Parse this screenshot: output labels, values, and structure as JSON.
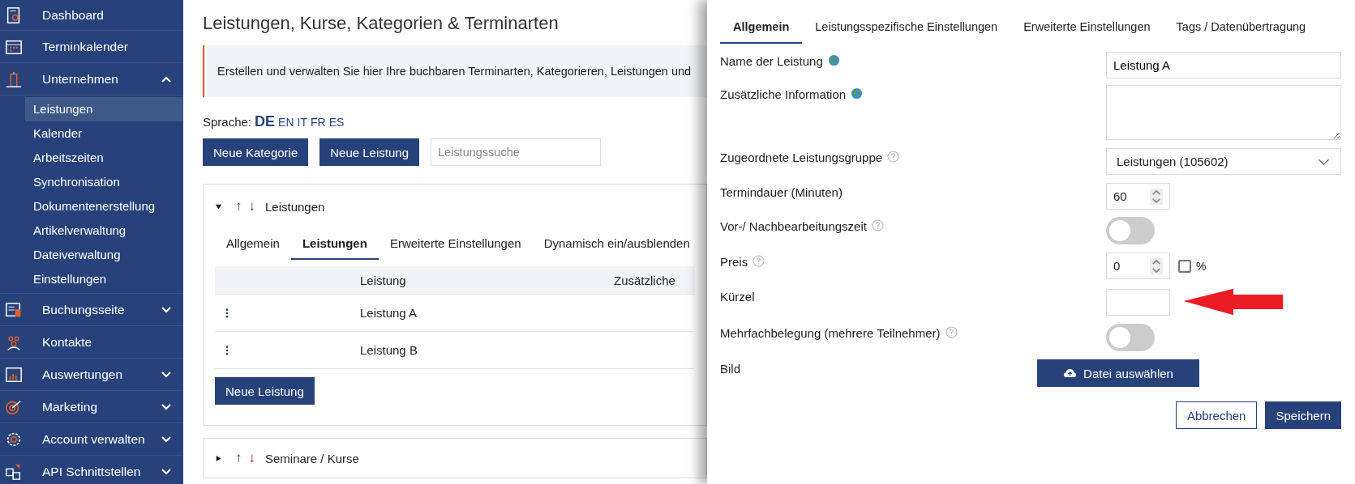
{
  "sidebar": {
    "items": [
      {
        "label": "Dashboard"
      },
      {
        "label": "Terminkalender"
      },
      {
        "label": "Unternehmen",
        "expanded": true,
        "children": [
          {
            "label": "Leistungen",
            "selected": true
          },
          {
            "label": "Kalender",
            "selected": false
          },
          {
            "label": "Arbeitszeiten",
            "selected": false
          },
          {
            "label": "Synchronisation",
            "selected": false
          },
          {
            "label": "Dokumentenerstellung",
            "selected": false
          },
          {
            "label": "Artikelverwaltung",
            "selected": false
          },
          {
            "label": "Dateiverwaltung",
            "selected": false
          },
          {
            "label": "Einstellungen",
            "selected": false
          }
        ]
      },
      {
        "label": "Buchungsseite",
        "expanded": false
      },
      {
        "label": "Kontakte"
      },
      {
        "label": "Auswertungen",
        "expanded": false
      },
      {
        "label": "Marketing",
        "expanded": false
      },
      {
        "label": "Account verwalten",
        "expanded": false
      },
      {
        "label": "API Schnittstellen",
        "expanded": false
      }
    ]
  },
  "main": {
    "title": "Leistungen, Kurse, Kategorien & Terminarten",
    "info": "Erstellen und verwalten Sie hier Ihre buchbaren Terminarten, Kategorieren, Leistungen und",
    "language_label": "Sprache:",
    "languages": [
      {
        "code": "DE",
        "selected": true
      },
      {
        "code": "EN",
        "selected": false
      },
      {
        "code": "IT",
        "selected": false
      },
      {
        "code": "FR",
        "selected": false
      },
      {
        "code": "ES",
        "selected": false
      }
    ],
    "buttons": [
      "Neue Kategorie",
      "Neue Leistung"
    ],
    "search": {
      "placeholder": "Leistungssuche"
    },
    "sections": [
      {
        "title": "Leistungen",
        "up": "↑",
        "down": "↓",
        "expanded": true,
        "tabs": [
          {
            "label": "Allgemein",
            "selected": false
          },
          {
            "label": "Leistungen",
            "selected": true
          },
          {
            "label": "Erweiterte Einstellungen",
            "selected": false
          },
          {
            "label": "Dynamisch ein/ausblenden",
            "selected": false
          }
        ],
        "table": {
          "columns": [
            "Leistung",
            "Zusätzliche"
          ],
          "rows": [
            {
              "cells": [
                "Leistung A"
              ]
            },
            {
              "cells": [
                "Leistung B"
              ]
            }
          ]
        },
        "add_button": "Neue Leistung"
      },
      {
        "title": "Seminare / Kurse",
        "up": "↑",
        "down": "↓",
        "expanded": false
      }
    ]
  },
  "panel": {
    "tabs": [
      {
        "label": "Allgemein",
        "selected": true
      },
      {
        "label": "Leistungsspezifische Einstellungen",
        "selected": false
      },
      {
        "label": "Erweiterte Einstellungen",
        "selected": false
      },
      {
        "label": "Tags / Datenübertragung",
        "selected": false
      }
    ],
    "fields": [
      {
        "label": "Name der Leistung",
        "translatable": true,
        "kind": "text",
        "value": "Leistung A"
      },
      {
        "label": "Zusätzliche Information",
        "translatable": true,
        "kind": "textarea"
      },
      {
        "label": "Zugeordnete Leistungsgruppe",
        "help": true,
        "kind": "select",
        "value": "Leistungen (105602)"
      },
      {
        "label": "Termindauer (Minuten)",
        "kind": "number",
        "value": "60"
      },
      {
        "label": "Vor-/ Nachbearbeitungszeit",
        "help": true,
        "kind": "toggle",
        "on": false
      },
      {
        "label": "Preis",
        "help": true,
        "kind": "number",
        "value": "0",
        "checkbox": {
          "label": "%",
          "checked": false
        }
      },
      {
        "label": "Kürzel",
        "kind": "text",
        "marked": true
      },
      {
        "label": "Mehrfachbelegung (mehrere Teilnehmer)",
        "help": true,
        "kind": "toggle",
        "on": false
      },
      {
        "label": "Bild",
        "kind": "file",
        "button": "Datei auswählen"
      }
    ],
    "buttons": [
      {
        "label": "Abbrechen",
        "kind": "secondary"
      },
      {
        "label": "Speichern",
        "kind": "primary"
      }
    ]
  }
}
